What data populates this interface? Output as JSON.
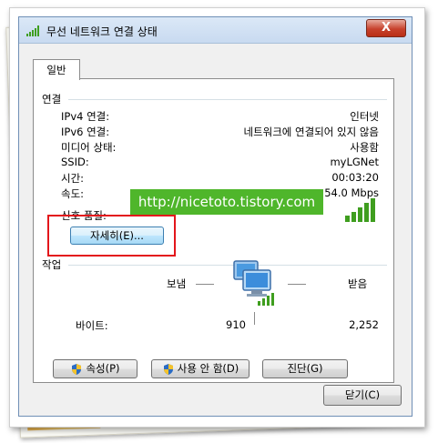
{
  "window": {
    "title": "무선 네트워크 연결 상태",
    "close_glyph": "X"
  },
  "tabs": [
    {
      "label": "일반"
    }
  ],
  "connection": {
    "group_title": "연결",
    "rows": [
      {
        "label": "IPv4 연결:",
        "value": "인터넷"
      },
      {
        "label": "IPv6 연결:",
        "value": "네트워크에 연결되어 있지 않음"
      },
      {
        "label": "미디어 상태:",
        "value": "사용함"
      },
      {
        "label": "SSID:",
        "value": "myLGNet"
      },
      {
        "label": "시간:",
        "value": "00:03:20"
      },
      {
        "label": "속도:",
        "value": "54.0 Mbps"
      }
    ],
    "signal_label": "신호 품질:",
    "details_button": "자세히(E)..."
  },
  "activity": {
    "group_title": "작업",
    "sent_label": "보냄",
    "received_label": "받음",
    "bytes_label": "바이트:",
    "bytes_sent": "910",
    "bytes_received": "2,252"
  },
  "buttons": {
    "properties": "속성(P)",
    "disable": "사용 안 함(D)",
    "diagnose": "진단(G)",
    "close": "닫기(C)"
  },
  "watermark": "http://nicetoto.tistory.com",
  "colors": {
    "signal_green": "#3f9e1f",
    "highlight_red": "#e3161b",
    "watermark_green": "#4fb62b"
  }
}
